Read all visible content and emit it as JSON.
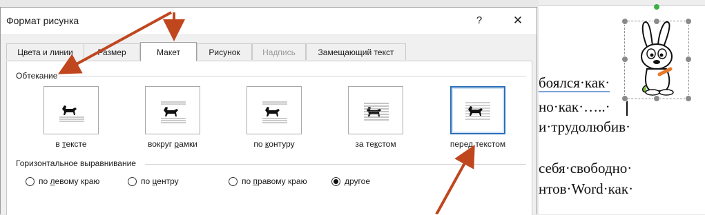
{
  "dialog": {
    "title": "Формат рисунка",
    "help_label": "?",
    "close_label": "✕",
    "tabs": [
      {
        "label": "Цвета и линии",
        "state": "normal"
      },
      {
        "label": "Размер",
        "state": "normal"
      },
      {
        "label": "Макет",
        "state": "active"
      },
      {
        "label": "Рисунок",
        "state": "normal"
      },
      {
        "label": "Надпись",
        "state": "disabled"
      },
      {
        "label": "Замещающий текст",
        "state": "normal"
      }
    ]
  },
  "wrapping": {
    "group_label": "Обтекание",
    "options": [
      {
        "label_pre": "в ",
        "label_ul": "т",
        "label_post": "ексте",
        "icon": "dog-inline-icon",
        "selected": false
      },
      {
        "label_pre": "вокруг ",
        "label_ul": "р",
        "label_post": "амки",
        "icon": "dog-square-icon",
        "selected": false
      },
      {
        "label_pre": "по ",
        "label_ul": "к",
        "label_post": "онтуру",
        "icon": "dog-tight-icon",
        "selected": false
      },
      {
        "label_pre": "за те",
        "label_ul": "к",
        "label_post": "стом",
        "icon": "dog-behind-icon",
        "selected": false
      },
      {
        "label_pre": "перед текстом",
        "label_ul": "",
        "label_post": "",
        "icon": "dog-front-icon",
        "selected": true
      }
    ]
  },
  "alignment": {
    "group_label": "Горизонтальное выравнивание",
    "options": [
      {
        "label_pre": "по ",
        "label_ul": "л",
        "label_post": "евому краю",
        "checked": false
      },
      {
        "label_pre": "по ",
        "label_ul": "ц",
        "label_post": "ентру",
        "checked": false
      },
      {
        "label_pre": "по ",
        "label_ul": "п",
        "label_post": "равому краю",
        "checked": false
      },
      {
        "label_pre": "",
        "label_ul": "д",
        "label_post": "ругое",
        "checked": true
      }
    ]
  },
  "document": {
    "lines": [
      "боялся·как·",
      "но·как·…..·",
      "и·трудолюбив·",
      "себя·свободно·",
      "нтов·Word·как·"
    ],
    "image": "rabbit-clipart"
  },
  "colors": {
    "arrow": "#c0461e",
    "selected_border": "#2a6fb8",
    "rotate_handle": "#3cb043"
  }
}
